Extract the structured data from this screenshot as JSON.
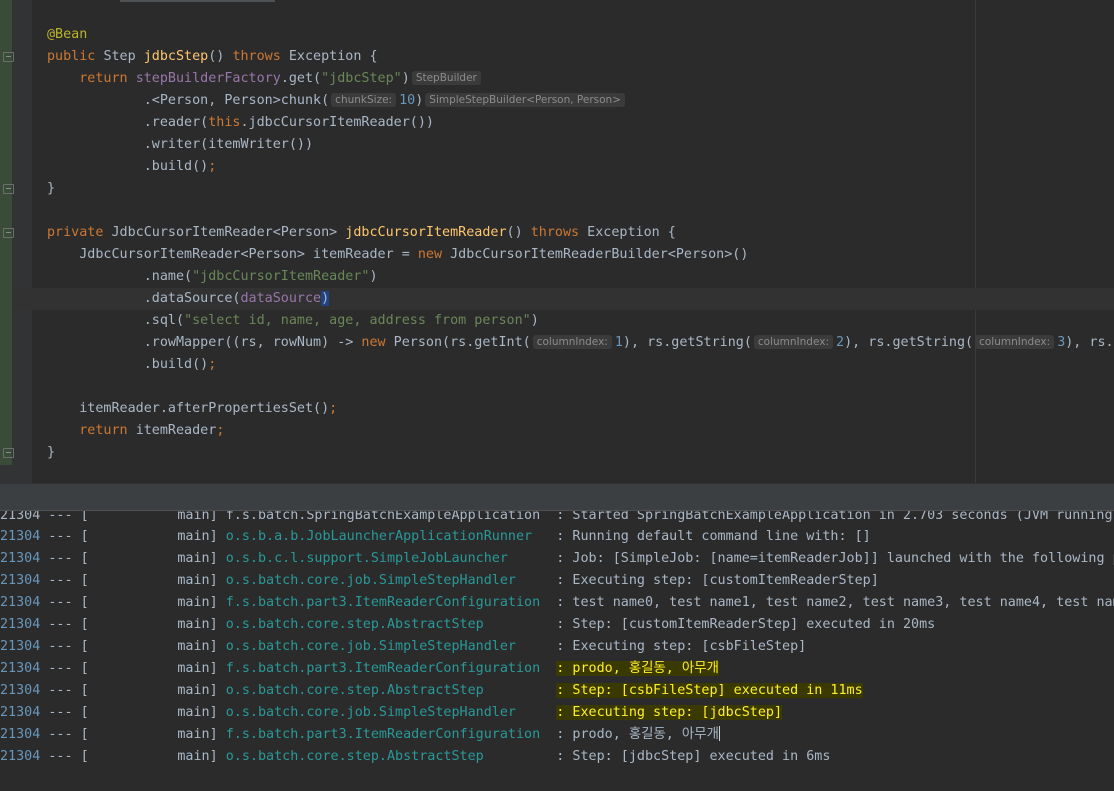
{
  "editor": {
    "lines": [
      {
        "parts": [
          {
            "c": "ann",
            "t": "@Bean"
          }
        ]
      },
      {
        "parts": [
          {
            "c": "kw",
            "t": "public "
          },
          {
            "t": "Step "
          },
          {
            "c": "fn",
            "t": "jdbcStep"
          },
          {
            "t": "() "
          },
          {
            "c": "kw",
            "t": "throws "
          },
          {
            "t": "Exception {"
          }
        ]
      },
      {
        "parts": [
          {
            "t": "    "
          },
          {
            "c": "kw",
            "t": "return "
          },
          {
            "c": "fld",
            "t": "stepBuilderFactory"
          },
          {
            "t": ".get("
          },
          {
            "c": "str",
            "t": "\"jdbcStep\""
          },
          {
            "t": ")"
          },
          {
            "c": "hint",
            "t": "StepBuilder"
          }
        ]
      },
      {
        "parts": [
          {
            "t": "            .<Person, Person>chunk("
          },
          {
            "c": "hint",
            "t": "chunkSize:"
          },
          {
            "c": "num",
            "t": "10"
          },
          {
            "t": ")"
          },
          {
            "c": "hint",
            "t": "SimpleStepBuilder<Person, Person>"
          }
        ]
      },
      {
        "parts": [
          {
            "t": "            .reader("
          },
          {
            "c": "kw",
            "t": "this"
          },
          {
            "t": ".jdbcCursorItemReader())"
          }
        ]
      },
      {
        "parts": [
          {
            "t": "            .writer(itemWriter())"
          }
        ]
      },
      {
        "parts": [
          {
            "t": "            .build()"
          },
          {
            "c": "kw",
            "t": ";"
          }
        ]
      },
      {
        "parts": [
          {
            "t": "}"
          }
        ]
      },
      {
        "parts": [
          {
            "t": ""
          }
        ]
      },
      {
        "parts": [
          {
            "c": "kw",
            "t": "private "
          },
          {
            "t": "JdbcCursorItemReader<Person> "
          },
          {
            "c": "fn",
            "t": "jdbcCursorItemReader"
          },
          {
            "t": "() "
          },
          {
            "c": "kw",
            "t": "throws "
          },
          {
            "t": "Exception {"
          }
        ]
      },
      {
        "parts": [
          {
            "t": "    JdbcCursorItemReader<Person> itemReader = "
          },
          {
            "c": "kw",
            "t": "new "
          },
          {
            "t": "JdbcCursorItemReaderBuilder<Person>()"
          }
        ]
      },
      {
        "parts": [
          {
            "t": "            .name("
          },
          {
            "c": "str",
            "t": "\"jdbcCursorItemReader\""
          },
          {
            "t": ")"
          }
        ]
      },
      {
        "parts": [
          {
            "t": "            .dataSource("
          },
          {
            "c": "fld",
            "t": "dataSource"
          },
          {
            "c": "hl",
            "t": ")"
          }
        ]
      },
      {
        "parts": [
          {
            "t": "            .sql("
          },
          {
            "c": "str",
            "t": "\"select id, name, age, address from person\""
          },
          {
            "t": ")"
          }
        ]
      },
      {
        "parts": [
          {
            "t": "            .rowMapper((rs, rowNum) -> "
          },
          {
            "c": "kw",
            "t": "new "
          },
          {
            "t": "Person(rs.getInt("
          },
          {
            "c": "hint",
            "t": "columnIndex:"
          },
          {
            "c": "num",
            "t": "1"
          },
          {
            "t": "), rs.getString("
          },
          {
            "c": "hint",
            "t": "columnIndex:"
          },
          {
            "c": "num",
            "t": "2"
          },
          {
            "t": "), rs.getString("
          },
          {
            "c": "hint",
            "t": "columnIndex:"
          },
          {
            "c": "num",
            "t": "3"
          },
          {
            "t": "), rs.getString("
          }
        ]
      },
      {
        "parts": [
          {
            "t": "            .build()"
          },
          {
            "c": "kw",
            "t": ";"
          }
        ]
      },
      {
        "parts": [
          {
            "t": ""
          }
        ]
      },
      {
        "parts": [
          {
            "t": "    itemReader.afterPropertiesSet()"
          },
          {
            "c": "kw",
            "t": ";"
          }
        ]
      },
      {
        "parts": [
          {
            "t": "    "
          },
          {
            "c": "kw",
            "t": "return "
          },
          {
            "t": "itemReader"
          },
          {
            "c": "kw",
            "t": ";"
          }
        ]
      },
      {
        "parts": [
          {
            "t": "}"
          }
        ]
      }
    ]
  },
  "console": {
    "partial_top": "21304 --- [           main] f.s.batch.SpringBatchExampleApplication  : Started SpringBatchExampleApplication in 2.703 seconds (JVM running",
    "rows": [
      {
        "pid": "21304",
        "thread": "main",
        "logger": "o.s.b.a.b.JobLauncherApplicationRunner",
        "msg": "Running default command line with: []",
        "mark": false
      },
      {
        "pid": "21304",
        "thread": "main",
        "logger": "o.s.b.c.l.support.SimpleJobLauncher",
        "msg": "Job: [SimpleJob: [name=itemReaderJob]] launched with the following p",
        "mark": false
      },
      {
        "pid": "21304",
        "thread": "main",
        "logger": "o.s.batch.core.job.SimpleStepHandler",
        "msg": "Executing step: [customItemReaderStep]",
        "mark": false
      },
      {
        "pid": "21304",
        "thread": "main",
        "logger": "f.s.batch.part3.ItemReaderConfiguration",
        "msg": "test name0, test name1, test name2, test name3, test name4, test nam",
        "mark": false
      },
      {
        "pid": "21304",
        "thread": "main",
        "logger": "o.s.batch.core.step.AbstractStep",
        "msg": "Step: [customItemReaderStep] executed in 20ms",
        "mark": false
      },
      {
        "pid": "21304",
        "thread": "main",
        "logger": "o.s.batch.core.job.SimpleStepHandler",
        "msg": "Executing step: [csbFileStep]",
        "mark": false
      },
      {
        "pid": "21304",
        "thread": "main",
        "logger": "f.s.batch.part3.ItemReaderConfiguration",
        "msg": "prodo, 홍길동, 아무개",
        "mark": true
      },
      {
        "pid": "21304",
        "thread": "main",
        "logger": "o.s.batch.core.step.AbstractStep",
        "msg": "Step: [csbFileStep] executed in 11ms",
        "mark": true
      },
      {
        "pid": "21304",
        "thread": "main",
        "logger": "o.s.batch.core.job.SimpleStepHandler",
        "msg": "Executing step: [jdbcStep]",
        "mark": true
      },
      {
        "pid": "21304",
        "thread": "main",
        "logger": "f.s.batch.part3.ItemReaderConfiguration",
        "msg": "prodo, 홍길동, 아무개",
        "mark": false,
        "cursor": true
      },
      {
        "pid": "21304",
        "thread": "main",
        "logger": "o.s.batch.core.step.AbstractStep",
        "msg": "Step: [jdbcStep] executed in 6ms",
        "mark": false
      }
    ]
  }
}
